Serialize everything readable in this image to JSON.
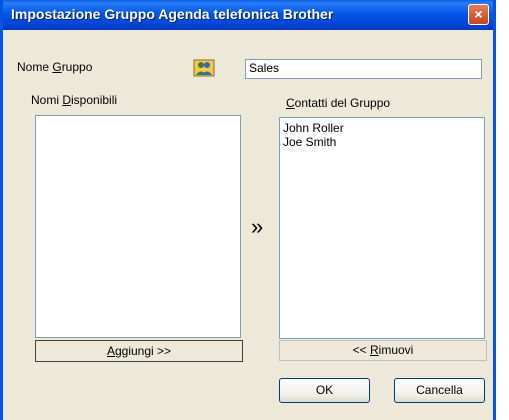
{
  "window": {
    "title": "Impostazione Gruppo Agenda telefonica Brother",
    "close_glyph": "×"
  },
  "group_name": {
    "label_pre": "Nome ",
    "label_key": "G",
    "label_post": "ruppo",
    "value": "Sales"
  },
  "available": {
    "label_pre": "Nomi ",
    "label_key": "D",
    "label_post": "isponibili",
    "items": []
  },
  "group_contacts": {
    "label_key": "C",
    "label_post": "ontatti del Gruppo",
    "items": [
      "John Roller",
      "Joe Smith"
    ]
  },
  "add_button": {
    "label_key": "A",
    "label_post": "ggiungi >>"
  },
  "remove_button": {
    "label_pre": "<< ",
    "label_key": "R",
    "label_post": "imuovi"
  },
  "move_arrow": "»",
  "ok_button": "OK",
  "cancel_button": "Cancella",
  "icons": {
    "group": "group-people-icon",
    "close": "close-icon",
    "arrow": "double-chevron-right-icon"
  }
}
